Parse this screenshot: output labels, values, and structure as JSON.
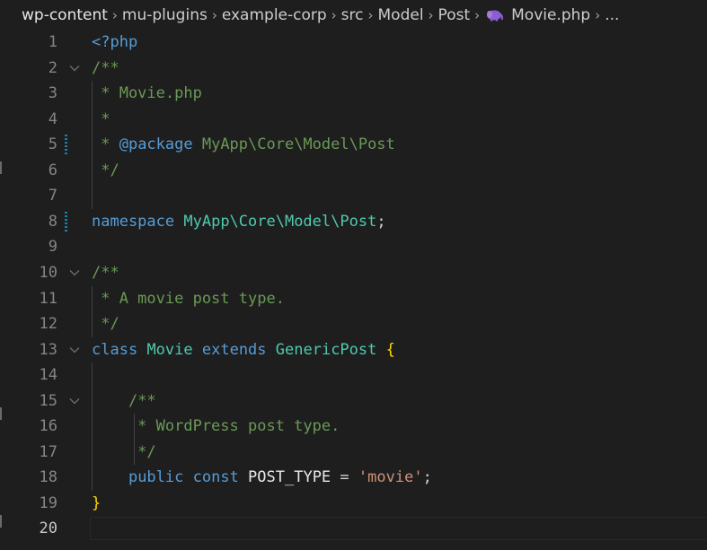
{
  "breadcrumb": {
    "items": [
      "wp-content",
      "mu-plugins",
      "example-corp",
      "src",
      "Model",
      "Post"
    ],
    "file": "Movie.php",
    "overflow": "...",
    "file_icon": "php-elephant-icon"
  },
  "colors": {
    "background": "#1e1e1e",
    "comment": "#6a9955",
    "keyword": "#569cd6",
    "type": "#4ec9b0",
    "string": "#ce9178",
    "brace": "#ffd700",
    "line_number": "#858585",
    "modified_marker": "#1b81a8"
  },
  "editor": {
    "current_line": 20,
    "lines": [
      {
        "n": "1",
        "tokens": [
          {
            "t": "<?php",
            "c": "keyword"
          }
        ]
      },
      {
        "n": "2",
        "fold": true,
        "tokens": [
          {
            "t": "/**",
            "c": "comment"
          }
        ]
      },
      {
        "n": "3",
        "tokens": [
          {
            "t": " * Movie.php",
            "c": "comment"
          }
        ]
      },
      {
        "n": "4",
        "tokens": [
          {
            "t": " *",
            "c": "comment"
          }
        ]
      },
      {
        "n": "5",
        "modified": true,
        "tokens": [
          {
            "t": " * ",
            "c": "comment"
          },
          {
            "t": "@package",
            "c": "doctag"
          },
          {
            "t": " MyApp\\Core\\Model\\Post",
            "c": "comment"
          }
        ]
      },
      {
        "n": "6",
        "tokens": [
          {
            "t": " */",
            "c": "comment"
          }
        ]
      },
      {
        "n": "7",
        "tokens": []
      },
      {
        "n": "8",
        "modified": true,
        "tokens": [
          {
            "t": "namespace",
            "c": "keyword"
          },
          {
            "t": " ",
            "c": "punct"
          },
          {
            "t": "MyApp\\Core\\Model\\Post",
            "c": "type"
          },
          {
            "t": ";",
            "c": "punct"
          }
        ]
      },
      {
        "n": "9",
        "tokens": []
      },
      {
        "n": "10",
        "fold": true,
        "tokens": [
          {
            "t": "/**",
            "c": "comment"
          }
        ]
      },
      {
        "n": "11",
        "tokens": [
          {
            "t": " * A movie post type.",
            "c": "comment"
          }
        ]
      },
      {
        "n": "12",
        "tokens": [
          {
            "t": " */",
            "c": "comment"
          }
        ]
      },
      {
        "n": "13",
        "fold": true,
        "tokens": [
          {
            "t": "class",
            "c": "keyword"
          },
          {
            "t": " ",
            "c": "punct"
          },
          {
            "t": "Movie",
            "c": "type"
          },
          {
            "t": " ",
            "c": "punct"
          },
          {
            "t": "extends",
            "c": "keyword"
          },
          {
            "t": " ",
            "c": "punct"
          },
          {
            "t": "GenericPost",
            "c": "type"
          },
          {
            "t": " ",
            "c": "punct"
          },
          {
            "t": "{",
            "c": "brace"
          }
        ]
      },
      {
        "n": "14",
        "tokens": []
      },
      {
        "n": "15",
        "fold": true,
        "tokens": [
          {
            "t": "    ",
            "c": "punct"
          },
          {
            "t": "/**",
            "c": "comment"
          }
        ]
      },
      {
        "n": "16",
        "tokens": [
          {
            "t": "     * WordPress post type.",
            "c": "comment"
          }
        ]
      },
      {
        "n": "17",
        "tokens": [
          {
            "t": "     */",
            "c": "comment"
          }
        ]
      },
      {
        "n": "18",
        "tokens": [
          {
            "t": "    ",
            "c": "punct"
          },
          {
            "t": "public",
            "c": "keyword"
          },
          {
            "t": " ",
            "c": "punct"
          },
          {
            "t": "const",
            "c": "keyword"
          },
          {
            "t": " POST_TYPE ",
            "c": "const"
          },
          {
            "t": "=",
            "c": "punct"
          },
          {
            "t": " ",
            "c": "punct"
          },
          {
            "t": "'movie'",
            "c": "string"
          },
          {
            "t": ";",
            "c": "punct"
          }
        ]
      },
      {
        "n": "19",
        "tokens": [
          {
            "t": "}",
            "c": "brace"
          }
        ]
      },
      {
        "n": "20",
        "tokens": []
      }
    ]
  }
}
